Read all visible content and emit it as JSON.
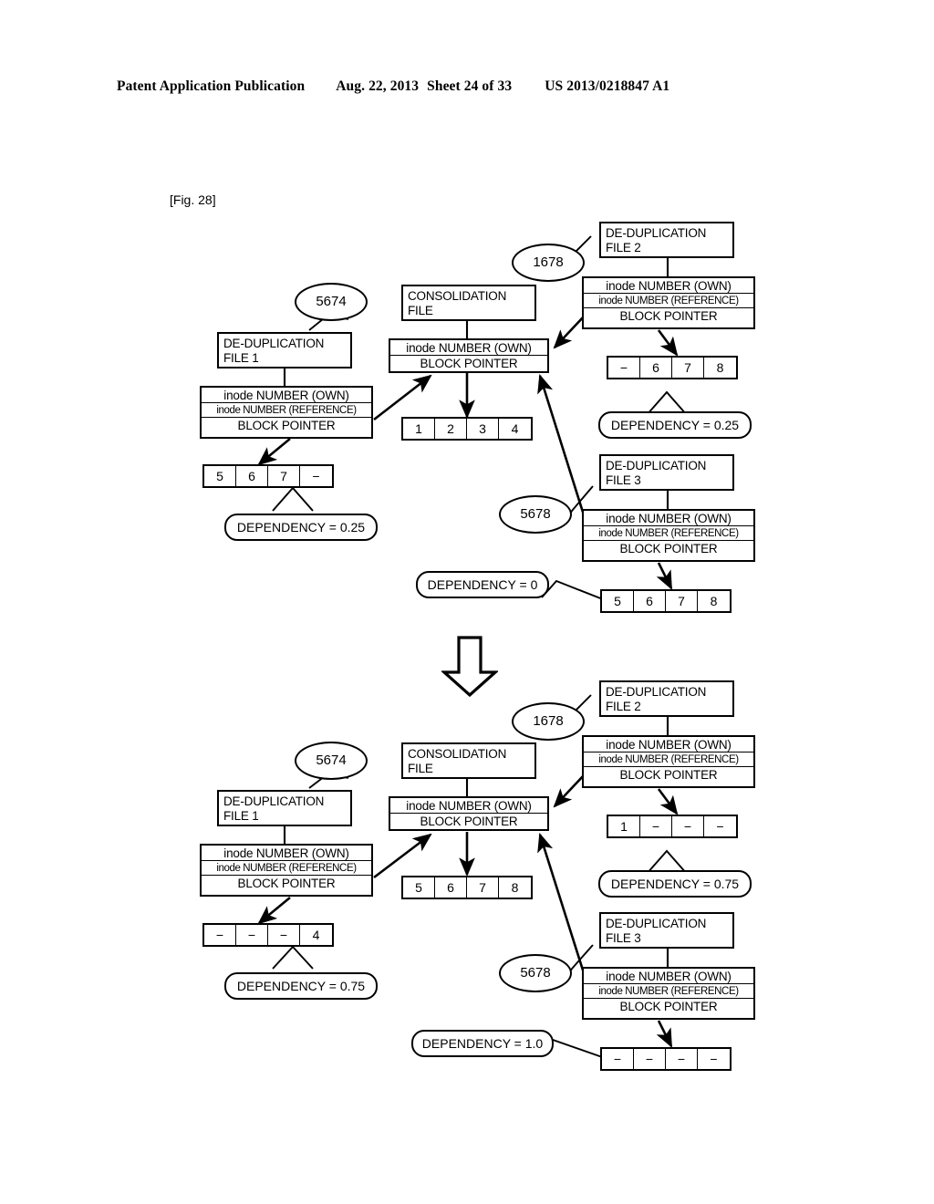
{
  "header": {
    "publication": "Patent Application Publication",
    "date": "Aug. 22, 2013",
    "sheet": "Sheet 24 of 33",
    "number": "US 2013/0218847 A1"
  },
  "figure_label": "[Fig. 28]",
  "labels": {
    "dedup_file_1": "DE-DUPLICATION\nFILE 1",
    "dedup_file_2": "DE-DUPLICATION\nFILE 2",
    "dedup_file_3": "DE-DUPLICATION\nFILE 3",
    "consolidation_file": "CONSOLIDATION\nFILE",
    "inode_own": "inode NUMBER (OWN)",
    "inode_reference": "inode NUMBER (REFERENCE)",
    "block_pointer": "BLOCK POINTER"
  },
  "diagrams": [
    {
      "id": "before",
      "name": "before-consolidation-state",
      "nodes": {
        "dedup1": {
          "title": "DE-DUPLICATION\nFILE 1",
          "ref_bubble": "5674",
          "inode_rows": [
            "inode NUMBER (OWN)",
            "inode NUMBER (REFERENCE)",
            "BLOCK POINTER"
          ],
          "blocks": [
            "5",
            "6",
            "7",
            "−"
          ],
          "dependency": "DEPENDENCY = 0.25"
        },
        "consolidation": {
          "title": "CONSOLIDATION\nFILE",
          "inode_rows": [
            "inode NUMBER (OWN)",
            "BLOCK POINTER"
          ],
          "blocks": [
            "1",
            "2",
            "3",
            "4"
          ]
        },
        "dedup2": {
          "title": "DE-DUPLICATION\nFILE 2",
          "ref_bubble": "1678",
          "inode_rows": [
            "inode NUMBER (OWN)",
            "inode NUMBER (REFERENCE)",
            "BLOCK POINTER"
          ],
          "blocks": [
            "−",
            "6",
            "7",
            "8"
          ],
          "dependency": "DEPENDENCY = 0.25"
        },
        "dedup3": {
          "title": "DE-DUPLICATION\nFILE 3",
          "ref_bubble": "5678",
          "inode_rows": [
            "inode NUMBER (OWN)",
            "inode NUMBER (REFERENCE)",
            "BLOCK POINTER"
          ],
          "blocks": [
            "5",
            "6",
            "7",
            "8"
          ],
          "dependency": "DEPENDENCY = 0"
        }
      }
    },
    {
      "id": "after",
      "name": "after-consolidation-state",
      "nodes": {
        "dedup1": {
          "title": "DE-DUPLICATION\nFILE 1",
          "ref_bubble": "5674",
          "inode_rows": [
            "inode NUMBER (OWN)",
            "inode NUMBER (REFERENCE)",
            "BLOCK POINTER"
          ],
          "blocks": [
            "−",
            "−",
            "−",
            "4"
          ],
          "dependency": "DEPENDENCY = 0.75"
        },
        "consolidation": {
          "title": "CONSOLIDATION\nFILE",
          "inode_rows": [
            "inode NUMBER (OWN)",
            "BLOCK POINTER"
          ],
          "blocks": [
            "5",
            "6",
            "7",
            "8"
          ]
        },
        "dedup2": {
          "title": "DE-DUPLICATION\nFILE 2",
          "ref_bubble": "1678",
          "inode_rows": [
            "inode NUMBER (OWN)",
            "inode NUMBER (REFERENCE)",
            "BLOCK POINTER"
          ],
          "blocks": [
            "1",
            "−",
            "−",
            "−"
          ],
          "dependency": "DEPENDENCY = 0.75"
        },
        "dedup3": {
          "title": "DE-DUPLICATION\nFILE 3",
          "ref_bubble": "5678",
          "inode_rows": [
            "inode NUMBER (OWN)",
            "inode NUMBER (REFERENCE)",
            "BLOCK POINTER"
          ],
          "blocks": [
            "−",
            "−",
            "−",
            "−"
          ],
          "dependency": "DEPENDENCY = 1.0"
        }
      }
    }
  ],
  "transition": {
    "icon": "down-block-arrow"
  },
  "colors": {
    "ink": "#000000",
    "paper": "#ffffff"
  }
}
